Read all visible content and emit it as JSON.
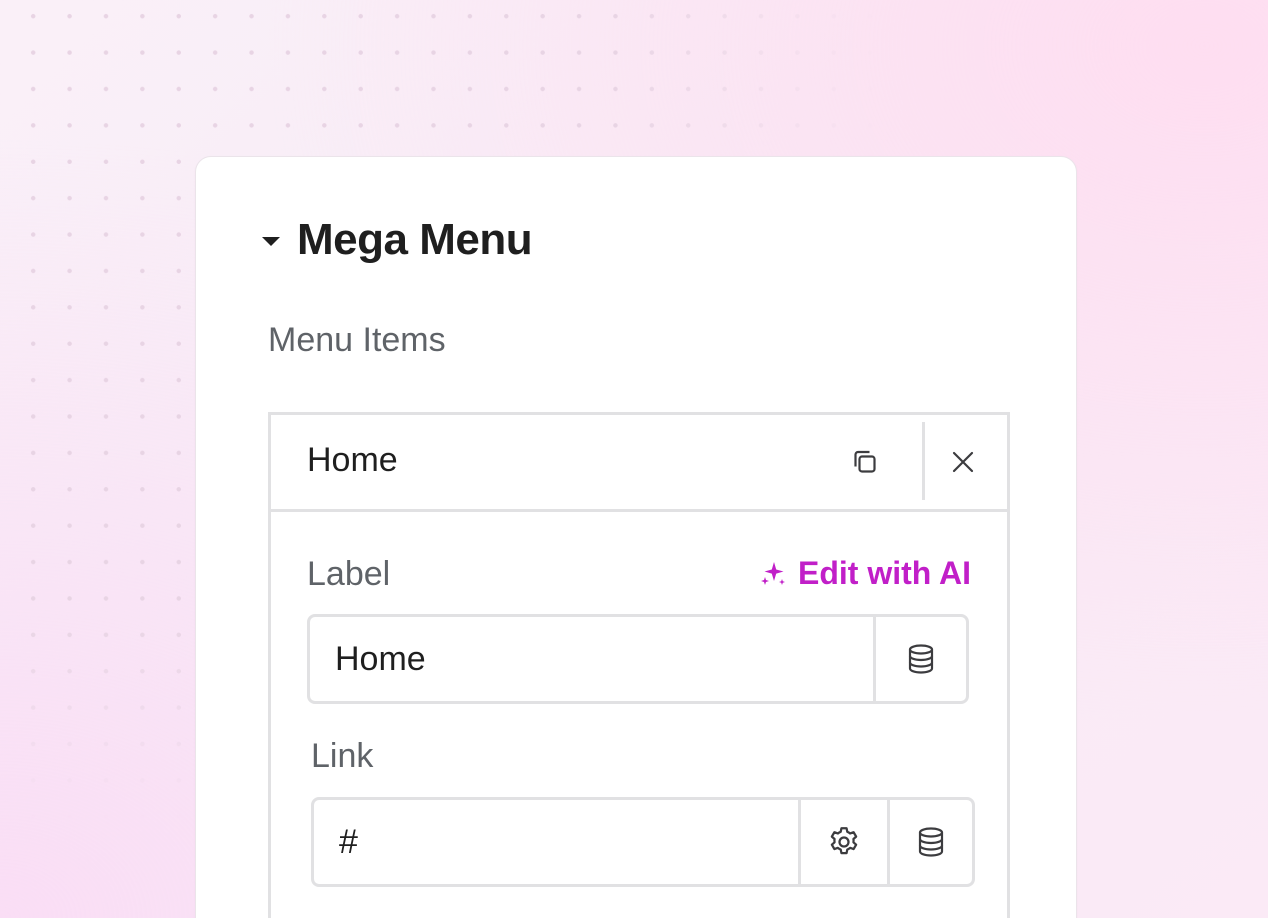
{
  "panel": {
    "title": "Mega Menu",
    "section_label": "Menu Items"
  },
  "menu_item": {
    "title": "Home",
    "label_field": {
      "label": "Label",
      "value": "Home"
    },
    "edit_ai_label": "Edit with AI",
    "link_field": {
      "label": "Link",
      "value": "#"
    }
  },
  "icons": {
    "collapse": "caret-down-icon",
    "duplicate": "duplicate-icon",
    "close": "close-icon",
    "ai": "sparkles-icon",
    "dynamic": "database-icon",
    "settings": "gear-icon"
  },
  "colors": {
    "accent": "#c11fc8",
    "text": "#1f1f1f",
    "muted": "#5f6368",
    "border": "#e1e1e3"
  }
}
